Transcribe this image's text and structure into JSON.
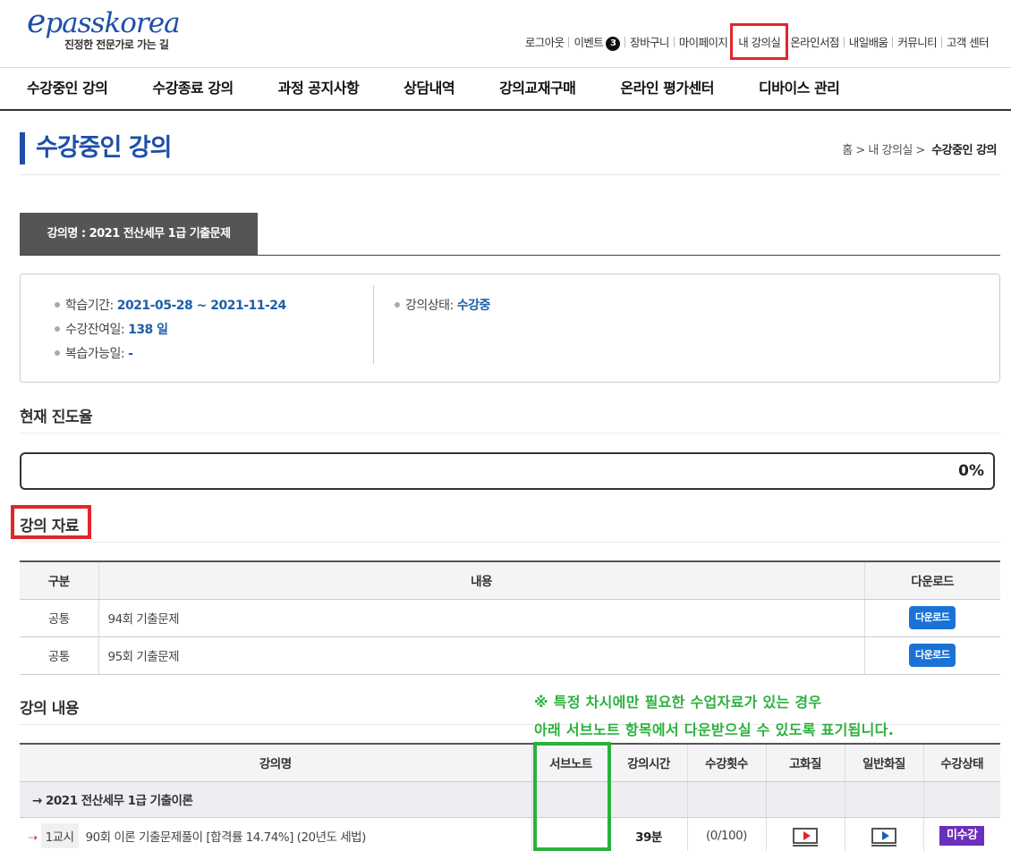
{
  "logo": {
    "brand": "passkorea",
    "brand_letter": "e",
    "tagline": "진정한 전문가로 가는 길"
  },
  "util_nav": [
    {
      "label": "로그아웃"
    },
    {
      "label": "이벤트",
      "badge": "3"
    },
    {
      "label": "장바구니"
    },
    {
      "label": "마이페이지"
    },
    {
      "label": "내 강의실",
      "highlight": true
    },
    {
      "label": "온라인서점"
    },
    {
      "label": "내일배움"
    },
    {
      "label": "커뮤니티"
    },
    {
      "label": "고객 센터"
    }
  ],
  "gnb": [
    "수강중인 강의",
    "수강종료 강의",
    "과정 공지사항",
    "상담내역",
    "강의교재구매",
    "온라인 평가센터",
    "디바이스 관리"
  ],
  "page": {
    "title": "수강중인 강의",
    "breadcrumb": {
      "home": "홈",
      "sep": ">",
      "parent": "내 강의실",
      "current": "수강중인 강의"
    }
  },
  "course": {
    "tab": "강의명 : 2021 전산세무 1급 기출문제",
    "period_label": "학습기간:",
    "period": "2021-05-28 ~ 2021-11-24",
    "remain_label": "수강잔여일:",
    "remain": "138 일",
    "review_label": "복습가능일:",
    "review": "-",
    "status_label": "강의상태:",
    "status": "수강중"
  },
  "progress": {
    "title": "현재 진도율",
    "value": 0,
    "label": "0%"
  },
  "materials": {
    "title": "강의 자료",
    "headers": [
      "구분",
      "내용",
      "다운로드"
    ],
    "rows": [
      {
        "type": "공통",
        "content": "94회 기출문제",
        "button": "다운로드"
      },
      {
        "type": "공통",
        "content": "95회 기출문제",
        "button": "다운로드"
      }
    ]
  },
  "lectures": {
    "title": "강의 내용",
    "note_line1": "※ 특정 차시에만 필요한 수업자료가 있는 경우",
    "note_line2": "아래 서브노트 항목에서 다운받으실 수 있도록 표기됩니다.",
    "headers": [
      "강의명",
      "서브노트",
      "강의시간",
      "수강횟수",
      "고화질",
      "일반화질",
      "수강상태"
    ],
    "group": "→ 2021 전산세무 1급 기출이론",
    "rows": [
      {
        "arrow": "⇢",
        "period": "1교시",
        "name": "90회 이론 기출문제풀이 [합격률 14.74%] (20년도 세법)",
        "subnote": "",
        "time": "39분",
        "count": "(0/100)",
        "status": "미수강"
      }
    ]
  },
  "colors": {
    "brand_blue": "#1e4fa8",
    "highlight_red": "#e0262b",
    "note_green": "#2bb13c",
    "status_purple": "#6a2fbd",
    "download_blue": "#1a72d6"
  }
}
